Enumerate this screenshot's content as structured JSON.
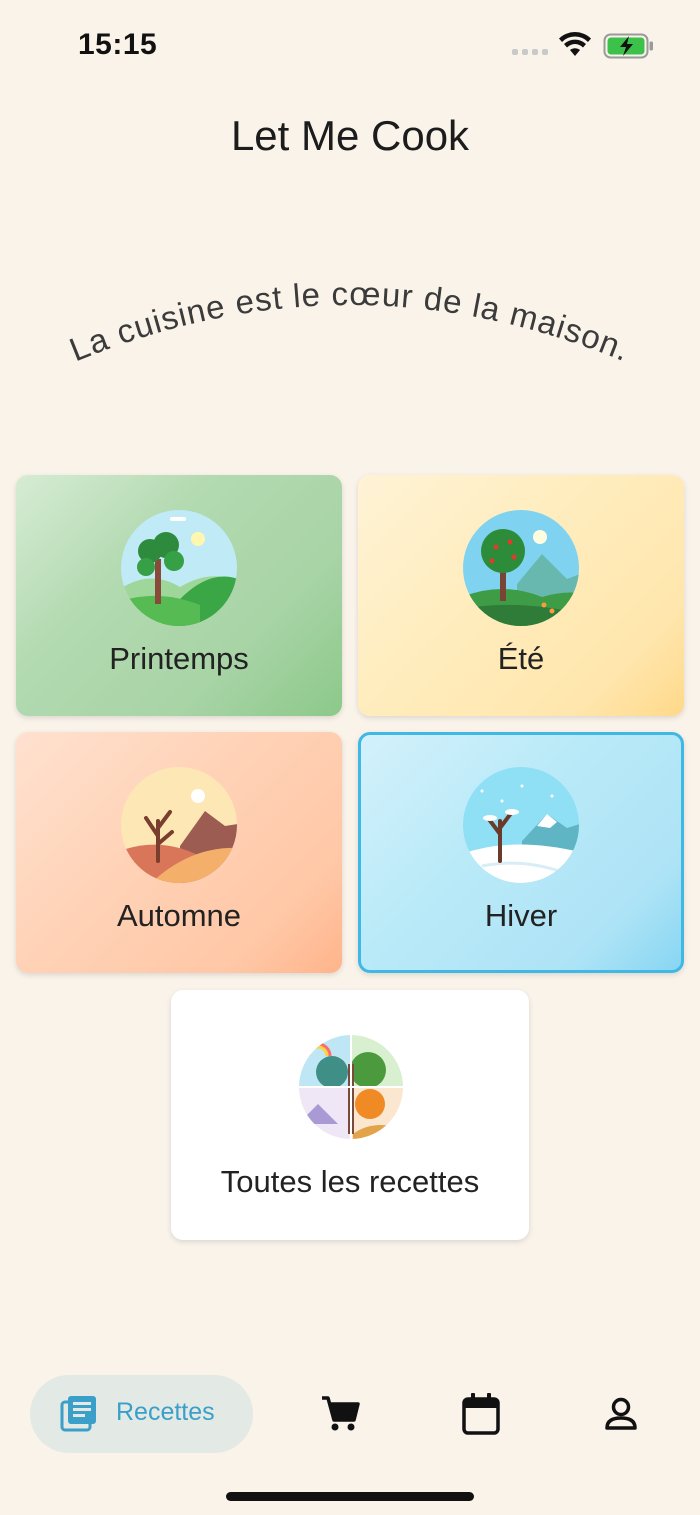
{
  "status": {
    "time": "15:15"
  },
  "app": {
    "title": "Let Me Cook",
    "tagline": "La cuisine est le cœur de la maison."
  },
  "seasons": [
    {
      "label": "Printemps",
      "icon": "spring-landscape-icon",
      "color": "#b3dab1"
    },
    {
      "label": "Été",
      "icon": "summer-landscape-icon",
      "color": "#ffedbf"
    },
    {
      "label": "Automne",
      "icon": "autumn-landscape-icon",
      "color": "#ffd3b8"
    },
    {
      "label": "Hiver",
      "icon": "winter-landscape-icon",
      "color": "#baeaf8",
      "selected": true
    }
  ],
  "all_recipes": {
    "label": "Toutes les recettes",
    "icon": "four-seasons-tree-icon"
  },
  "bottom_nav": {
    "items": [
      {
        "label": "Recettes",
        "icon": "recipes-icon",
        "active": true
      },
      {
        "label": "",
        "icon": "cart-icon"
      },
      {
        "label": "",
        "icon": "calendar-icon"
      },
      {
        "label": "",
        "icon": "user-icon"
      }
    ]
  },
  "colors": {
    "background": "#f9f3ea",
    "accent": "#3a9fc9",
    "winter_border": "#3fb8e6"
  }
}
